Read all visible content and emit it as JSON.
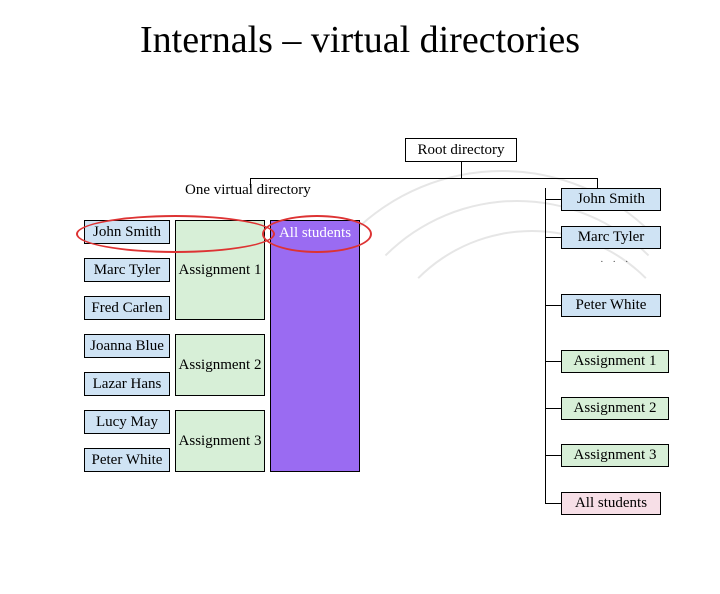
{
  "title": "Internals – virtual directories",
  "root_box": "Root directory",
  "vdir_label": "One virtual directory",
  "students": {
    "col": [
      "John Smith",
      "Marc Tyler",
      "Fred Carlen",
      "Joanna Blue",
      "Lazar Hans",
      "Lucy May",
      "Peter White"
    ]
  },
  "assignments": {
    "a1": "Assignment 1",
    "a2": "Assignment 2",
    "a3": "Assignment 3"
  },
  "all_students": "All students",
  "tree": {
    "john": "John Smith",
    "marc": "Marc Tyler",
    "peter": "Peter White",
    "a1": "Assignment 1",
    "a2": "Assignment 2",
    "a3": "Assignment 3",
    "all": "All students"
  }
}
